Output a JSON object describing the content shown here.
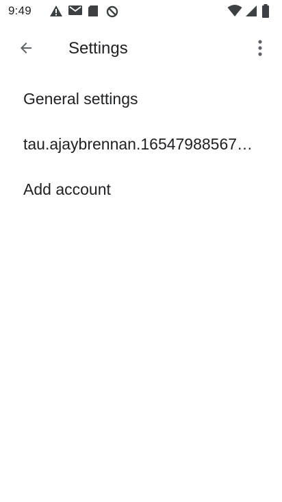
{
  "status_bar": {
    "time": "9:49",
    "left_icons": [
      "warning-icon",
      "gmail-icon",
      "sd-card-icon",
      "data-saver-icon"
    ],
    "right_icons": [
      "wifi-icon",
      "cell-signal-icon",
      "battery-icon"
    ]
  },
  "app_bar": {
    "title": "Settings",
    "back_icon": "arrow-back-icon",
    "overflow_icon": "more-vert-icon"
  },
  "list": {
    "items": [
      {
        "label": "General settings"
      },
      {
        "label": "tau.ajaybrennan.16547988567…"
      },
      {
        "label": "Add account"
      }
    ]
  },
  "colors": {
    "background": "#ffffff",
    "text": "#202124",
    "icon": "#5f6368"
  }
}
